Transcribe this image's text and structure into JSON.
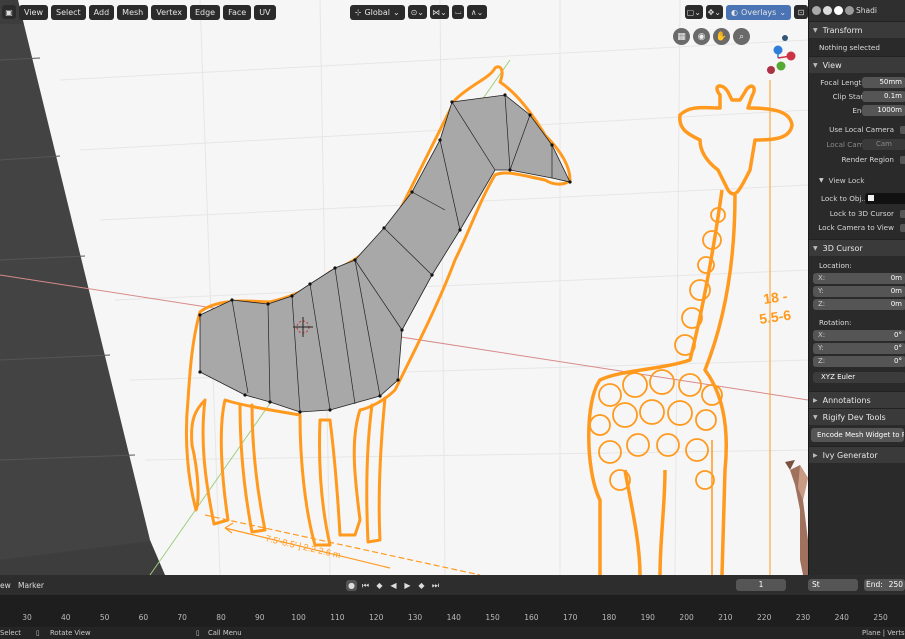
{
  "header": {
    "menus": [
      "View",
      "Select",
      "Add",
      "Mesh",
      "Vertex",
      "Edge",
      "Face",
      "UV"
    ],
    "orientation": "Global",
    "overlays_label": "Overlays",
    "shading_label": "Shadi"
  },
  "sidebar": {
    "transform": {
      "title": "Transform",
      "status": "Nothing selected"
    },
    "view": {
      "title": "View",
      "focal_length_label": "Focal Length",
      "focal_length_value": "50mm",
      "clip_start_label": "Clip Start",
      "clip_start_value": "0.1m",
      "end_label": "End",
      "end_value": "1000m",
      "use_local_camera": "Use Local Camera",
      "local_cam_label": "Local Cam.",
      "local_cam_value": "Cam",
      "render_region": "Render Region"
    },
    "view_lock": {
      "title": "View Lock",
      "lock_to_object": "Lock to Obj..",
      "lock_to_3d_cursor": "Lock to 3D Cursor",
      "lock_camera_to_view": "Lock Camera to View"
    },
    "cursor": {
      "title": "3D Cursor",
      "location_label": "Location:",
      "x_label": "X:",
      "x_value": "0m",
      "y_label": "Y:",
      "y_value": "0m",
      "z_label": "Z:",
      "z_value": "0m",
      "rotation_label": "Rotation:",
      "rx_label": "X:",
      "rx_value": "0°",
      "ry_label": "Y:",
      "ry_value": "0°",
      "rz_label": "Z:",
      "rz_value": "0°",
      "mode": "XYZ Euler"
    },
    "annotations": {
      "title": "Annotations"
    },
    "rigify": {
      "title": "Rigify Dev Tools",
      "button": "Encode Mesh Widget to Py.."
    },
    "ivy": {
      "title": "Ivy Generator"
    }
  },
  "reference_image": {
    "dims_length": "7.5'-8.5' | 2.2-2.6 m",
    "dims_height_ft": "18 -",
    "dims_height_m": "5.5-6"
  },
  "timeline": {
    "view_label": "ew",
    "marker_label": "Marker",
    "current_frame": "1",
    "start_label": "St",
    "end_label": "End:",
    "end_value": "250",
    "ruler_ticks": [
      "30",
      "40",
      "50",
      "60",
      "70",
      "80",
      "90",
      "100",
      "110",
      "120",
      "130",
      "140",
      "150",
      "160",
      "170",
      "180",
      "190",
      "200",
      "210",
      "220",
      "230",
      "240",
      "250"
    ]
  },
  "status_bar": {
    "select": "Select",
    "rotate": "Rotate View",
    "call_menu": "Call Menu",
    "right": "Plane | Verts"
  },
  "colors": {
    "accent_orange": "#ff9a1f",
    "mesh_fill": "#a8a8a8",
    "viewport_bg": "#f6f6f6",
    "panel_bg": "#2a2a2a"
  }
}
